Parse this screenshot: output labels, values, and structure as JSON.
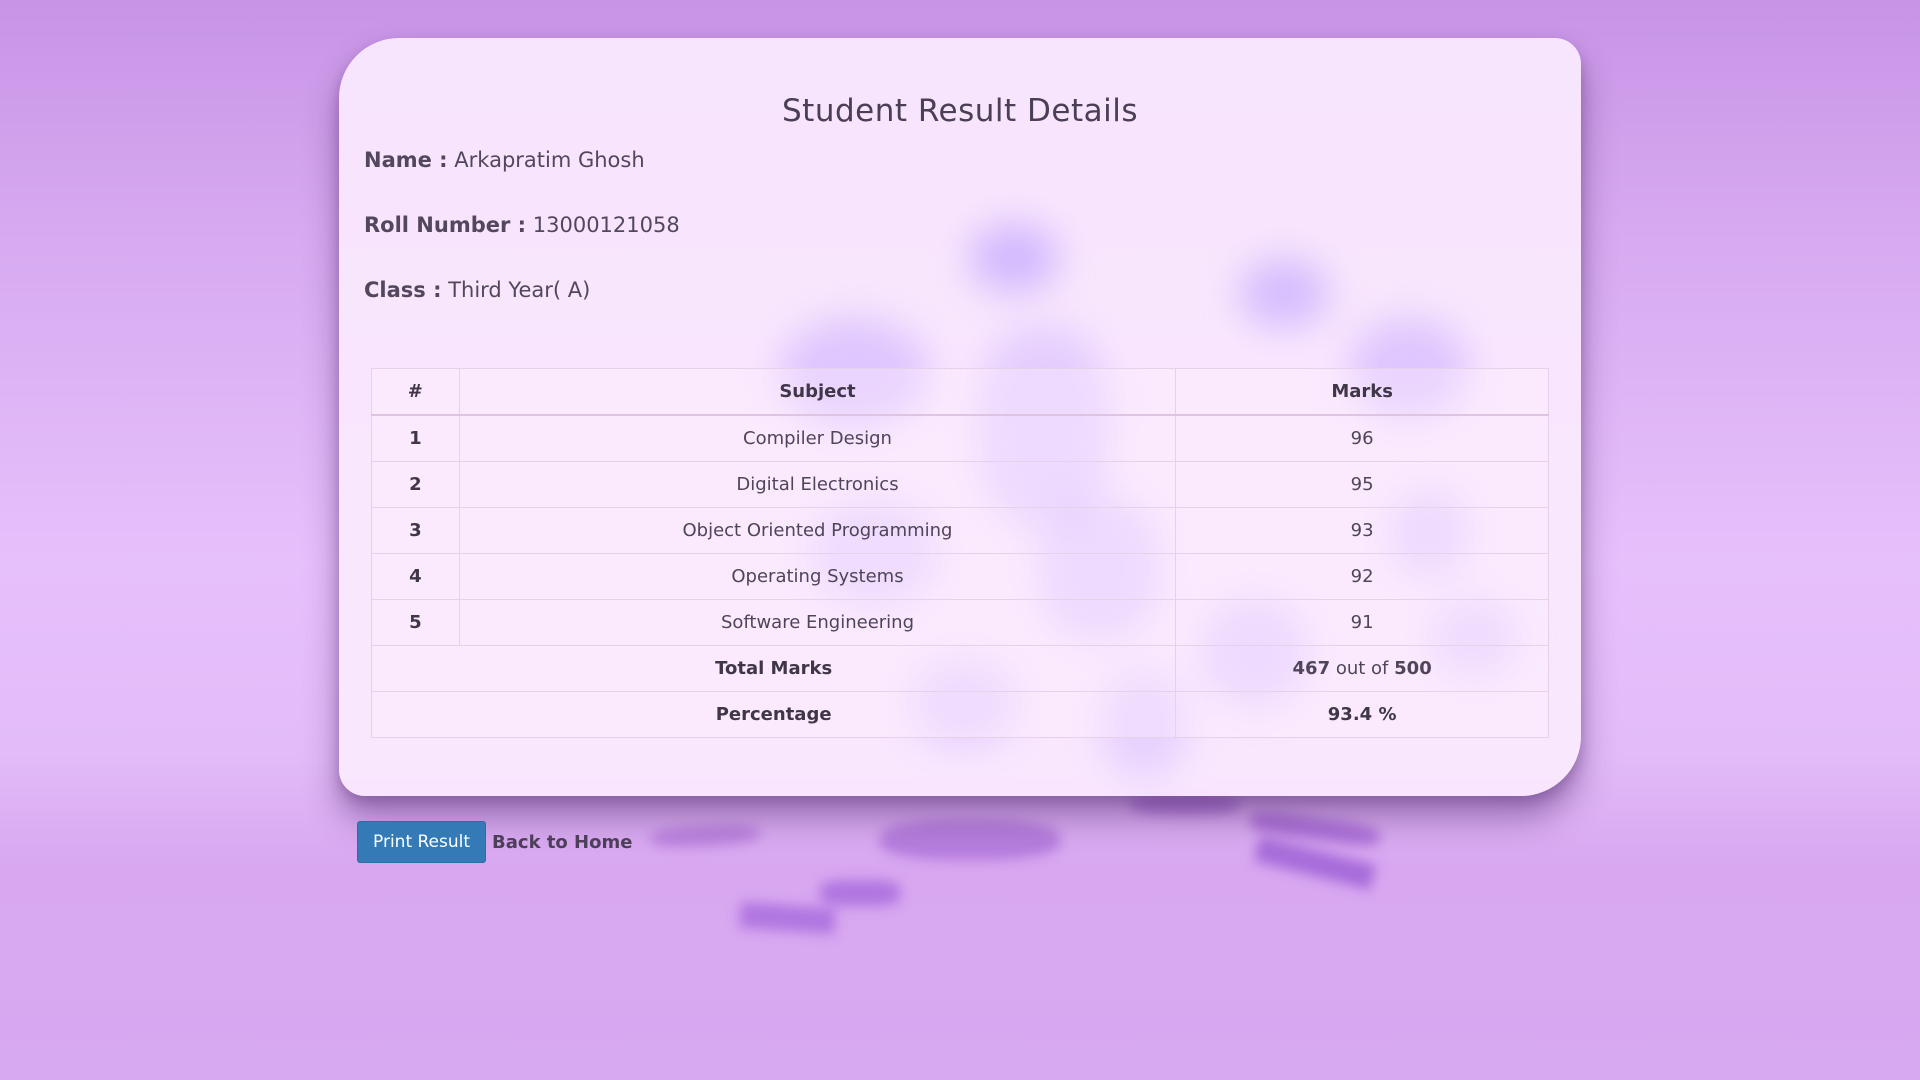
{
  "page": {
    "title": "Student Result Details"
  },
  "student": {
    "name_label": "Name :",
    "name_value": "Arkapratim Ghosh",
    "roll_label": "Roll Number :",
    "roll_value": "13000121058",
    "class_label": "Class :",
    "class_value": "Third Year( A)"
  },
  "table": {
    "headers": [
      "#",
      "Subject",
      "Marks"
    ],
    "rows": [
      {
        "num": "1",
        "subject": "Compiler Design",
        "marks": "96"
      },
      {
        "num": "2",
        "subject": "Digital Electronics",
        "marks": "95"
      },
      {
        "num": "3",
        "subject": "Object Oriented Programming",
        "marks": "93"
      },
      {
        "num": "4",
        "subject": "Operating Systems",
        "marks": "92"
      },
      {
        "num": "5",
        "subject": "Software Engineering",
        "marks": "91"
      }
    ],
    "total_label": "Total Marks",
    "total_obtained": "467",
    "total_sep": "out of",
    "total_max": "500",
    "percentage_label": "Percentage",
    "percentage_value": "93.4 %"
  },
  "actions": {
    "print_label": "Print Result",
    "home_label": "Back to Home"
  },
  "colors": {
    "primary_button": "#337ab7",
    "card_background": "#fbeafe",
    "page_background": "#d6a8f0"
  }
}
